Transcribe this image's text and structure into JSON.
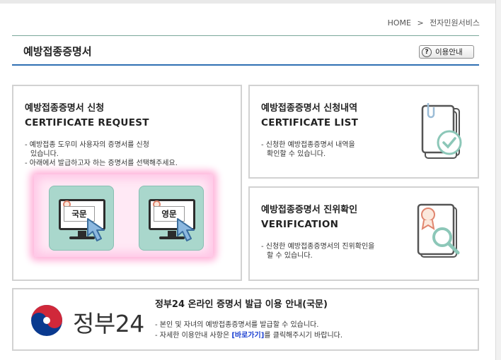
{
  "breadcrumb": {
    "home": "HOME",
    "sep": ">",
    "current": "전자민원서비스"
  },
  "header": {
    "title": "예방접종증명서",
    "help_label": "이용안내",
    "help_icon": "?"
  },
  "request": {
    "title_ko": "예방접종증명서 신청",
    "title_en": "CERTIFICATE REQUEST",
    "desc1": "- 예방접종 도우미 사용자의 증명서를 신청",
    "desc2": "  있습니다.",
    "desc3": "- 아래에서 발급하고자 하는 증명서를 선택해주세요.",
    "btn_korean": "국문",
    "btn_english": "영문"
  },
  "list": {
    "title_ko": "예방접종증명서 신청내역",
    "title_en": "CERTIFICATE LIST",
    "desc1": "- 신청한 예방접종증명서 내역을",
    "desc2": "  확인할 수 있습니다."
  },
  "verify": {
    "title_ko": "예방접종증명서 진위확인",
    "title_en": "VERIFICATION",
    "desc1": "- 신청한 예방접종증명서의 진위확인을",
    "desc2": "  할 수 있습니다."
  },
  "gov": {
    "logo_text": "정부24",
    "title": "정부24 온라인 증명서 발급 이용 안내(국문)",
    "desc1": "- 본인 및 자녀의 예방접종증명서를 발급할 수 있습니다.",
    "desc2_pre": "- 자세한 이용안내 사항은 ",
    "desc2_link": "[바로가기]",
    "desc2_post": "를 클릭해주시기 바랍니다."
  },
  "colors": {
    "accent_blue": "#2f6fb3",
    "mint": "#a9d7cc",
    "link": "#1a3fd1",
    "glow": "#ffb7dc"
  }
}
